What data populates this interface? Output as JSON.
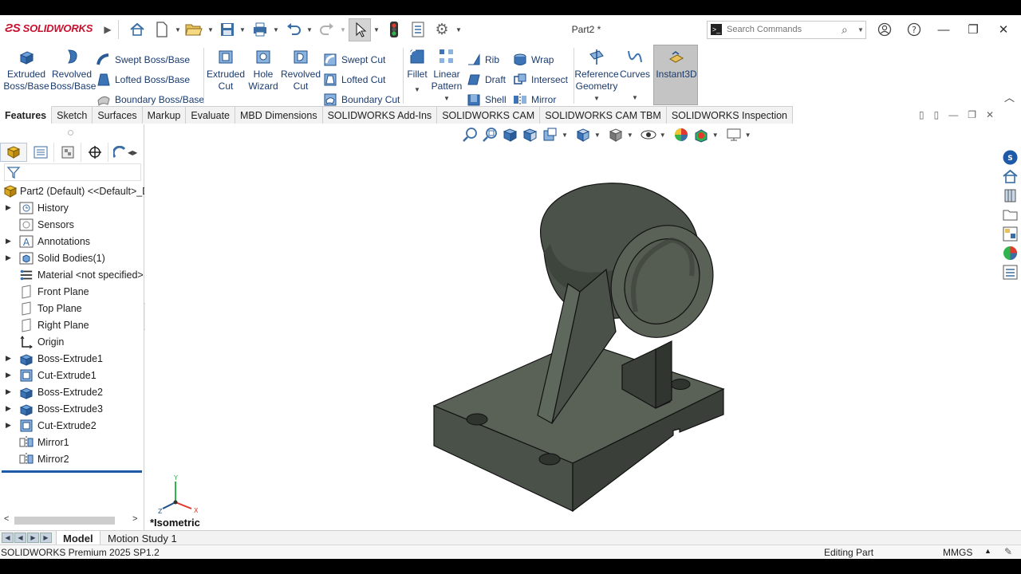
{
  "titlebar": {
    "logo_text": "SOLIDWORKS",
    "doc_title": "Part2 *",
    "search_placeholder": "Search Commands"
  },
  "commands": {
    "extruded_boss": "Extruded Boss/Base",
    "revolved_boss": "Revolved Boss/Base",
    "swept_boss": "Swept Boss/Base",
    "lofted_boss": "Lofted Boss/Base",
    "boundary_boss": "Boundary Boss/Base",
    "extruded_cut": "Extruded Cut",
    "hole_wizard": "Hole Wizard",
    "revolved_cut": "Revolved Cut",
    "swept_cut": "Swept Cut",
    "lofted_cut": "Lofted Cut",
    "boundary_cut": "Boundary Cut",
    "fillet": "Fillet",
    "linear_pattern": "Linear Pattern",
    "rib": "Rib",
    "draft": "Draft",
    "shell": "Shell",
    "wrap": "Wrap",
    "intersect": "Intersect",
    "mirror": "Mirror",
    "reference_geometry": "Reference Geometry",
    "curves": "Curves",
    "instant3d": "Instant3D"
  },
  "tabs": [
    "Features",
    "Sketch",
    "Surfaces",
    "Markup",
    "Evaluate",
    "MBD Dimensions",
    "SOLIDWORKS Add-Ins",
    "SOLIDWORKS CAM",
    "SOLIDWORKS CAM TBM",
    "SOLIDWORKS Inspection"
  ],
  "tree": {
    "root": "Part2 (Default) <<Default>_D",
    "items": [
      "History",
      "Sensors",
      "Annotations",
      "Solid Bodies(1)",
      "Material <not specified>",
      "Front Plane",
      "Top Plane",
      "Right Plane",
      "Origin",
      "Boss-Extrude1",
      "Cut-Extrude1",
      "Boss-Extrude2",
      "Boss-Extrude3",
      "Cut-Extrude2",
      "Mirror1",
      "Mirror2"
    ]
  },
  "viewport": {
    "view_label": "*Isometric",
    "triad": {
      "x": "X",
      "y": "Y",
      "z": "Z"
    }
  },
  "bottom_tabs": [
    "Model",
    "Motion Study 1"
  ],
  "status": {
    "version": "SOLIDWORKS Premium 2025 SP1.2",
    "mode": "Editing Part",
    "units": "MMGS"
  },
  "colors": {
    "brand_red": "#c8102e",
    "model_body": "#4a5148",
    "selection_blue": "#1e5aa8"
  }
}
